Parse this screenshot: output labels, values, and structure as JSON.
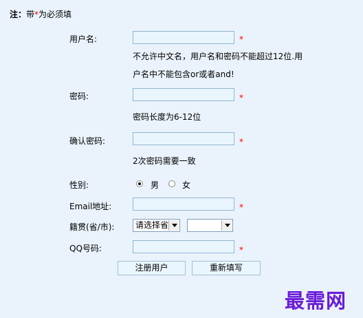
{
  "note": {
    "prefix": "注：",
    "text_before": "带",
    "star": "*",
    "text_after": "为必须填"
  },
  "fields": {
    "username": {
      "label": "用户名:",
      "value": "",
      "required": "*",
      "hint_line1": "不允许中文名，用户名和密码不能超过12位.用",
      "hint_line2": "户名中不能包含or或者and!"
    },
    "password": {
      "label": "密码:",
      "value": "",
      "required": "*",
      "hint": "密码长度为6-12位"
    },
    "confirm_password": {
      "label": "确认密码:",
      "value": "",
      "required": "*",
      "hint": "2次密码需要一致"
    },
    "gender": {
      "label": "性别:",
      "options": [
        "男",
        "女"
      ],
      "selected": "男"
    },
    "email": {
      "label": "Email地址:",
      "value": "",
      "required": "*"
    },
    "origin": {
      "label": "籍贯(省/市):",
      "province_selected": "请选择省",
      "city_selected": ""
    },
    "qq": {
      "label": "QQ号码:",
      "value": "",
      "required": "*"
    }
  },
  "buttons": {
    "register": "注册用户",
    "reset": "重新填写"
  },
  "watermark": "最需网"
}
